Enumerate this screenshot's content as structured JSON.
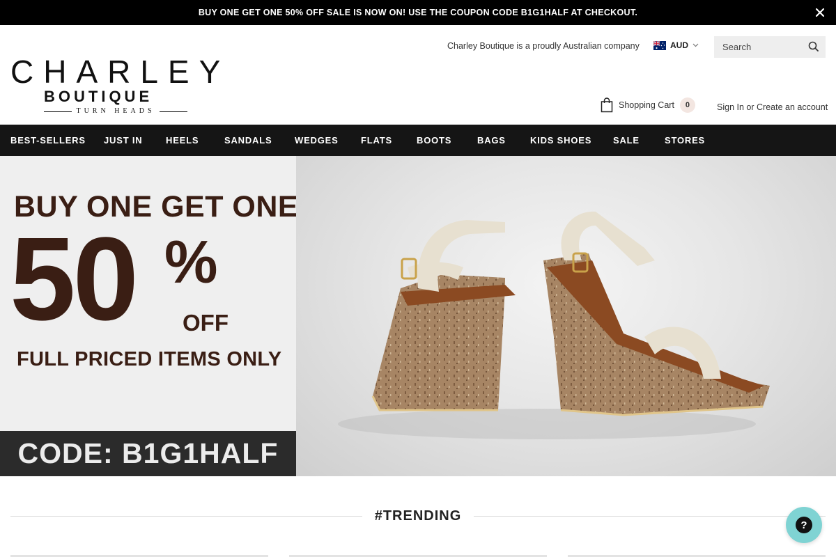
{
  "announcement": {
    "text": "BUY ONE GET ONE 50% OFF SALE IS NOW ON! USE THE COUPON CODE B1G1HALF AT CHECKOUT."
  },
  "header": {
    "logo": {
      "main": "CHARLEY",
      "sub": "BOUTIQUE",
      "tagline": "TURN HEADS"
    },
    "tagline": "Charley Boutique is a proudly Australian company",
    "currency": "AUD",
    "search": {
      "placeholder": "Search"
    },
    "cart": {
      "label": "Shopping Cart",
      "count": "0"
    },
    "account": {
      "sign_in": "Sign In",
      "or": "or",
      "create": "Create an account"
    }
  },
  "nav": {
    "items": [
      {
        "label": "BEST-SELLERS"
      },
      {
        "label": "JUST IN"
      },
      {
        "label": "HEELS"
      },
      {
        "label": "SANDALS"
      },
      {
        "label": "WEDGES"
      },
      {
        "label": "FLATS"
      },
      {
        "label": "BOOTS"
      },
      {
        "label": "BAGS"
      },
      {
        "label": "KIDS SHOES"
      },
      {
        "label": "SALE"
      },
      {
        "label": "STORES"
      }
    ]
  },
  "hero": {
    "line1": "BUY ONE GET ONE",
    "big": "50",
    "pct": "%",
    "off": "OFF",
    "full": "FULL PRICED ITEMS ONLY",
    "code": "CODE: B1G1HALF",
    "text_color": "#3a1e14"
  },
  "trending": {
    "title": "#TRENDING"
  },
  "chat": {
    "icon": "?"
  },
  "icons": {
    "close": "close-icon",
    "search": "search-icon",
    "cart": "shopping-bag-icon",
    "chat": "help-chat-icon",
    "flag": "australia-flag-icon"
  }
}
